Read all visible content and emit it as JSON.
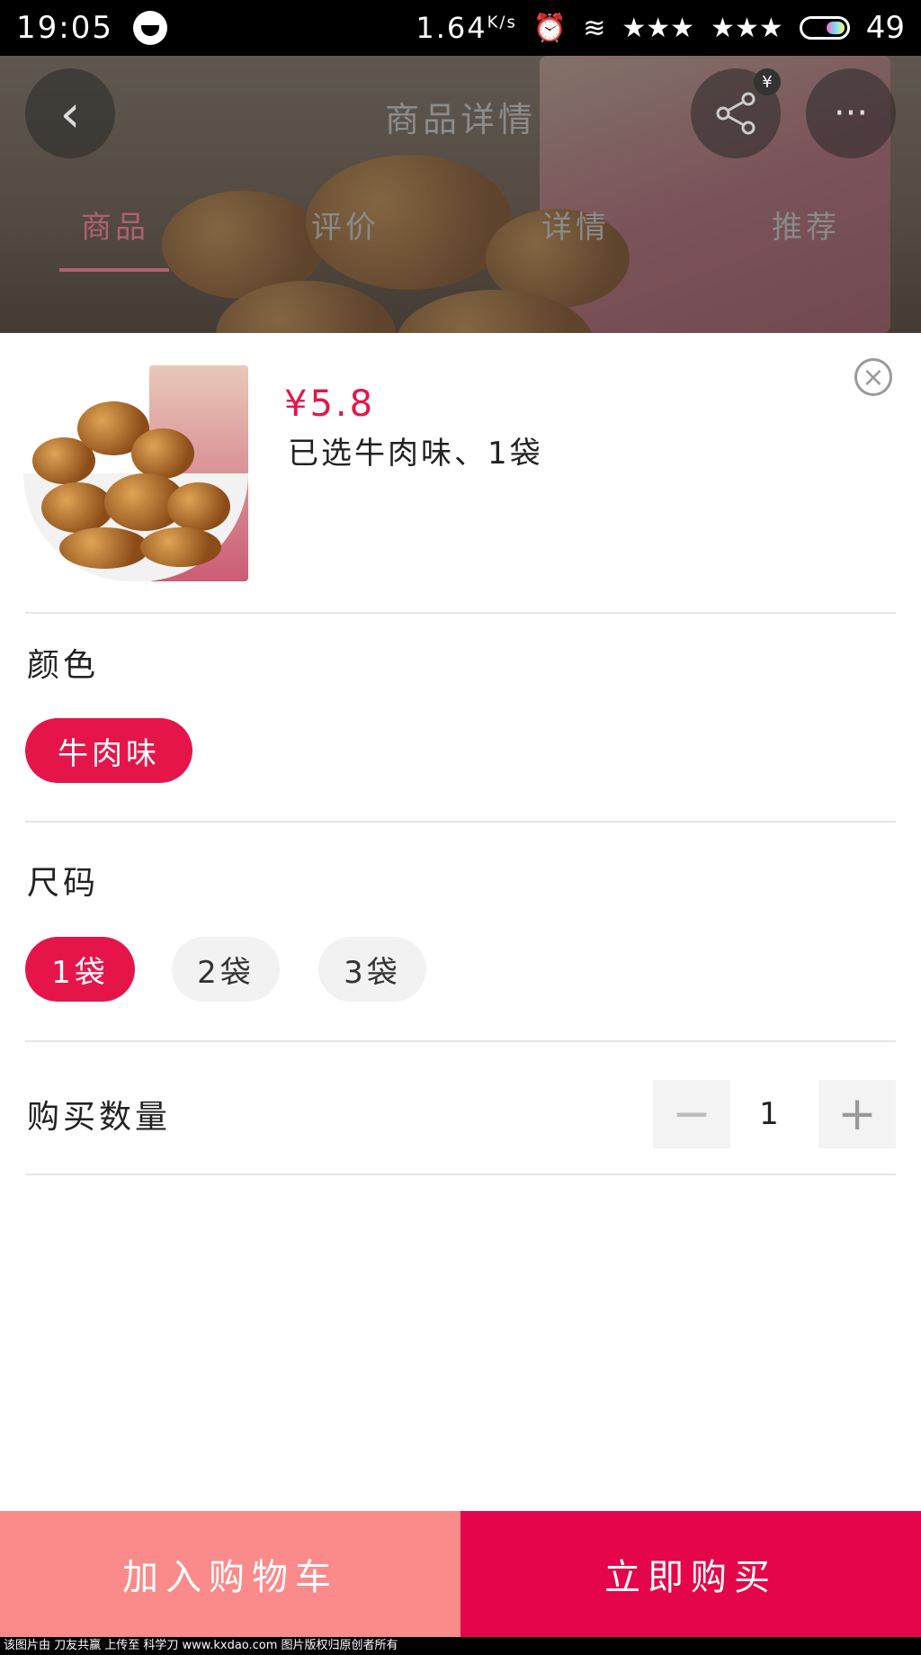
{
  "status_bar": {
    "time": "19:05",
    "speed": "1.64",
    "speed_unit": "K/s",
    "battery": "49"
  },
  "header": {
    "title": "商品详情",
    "back_icon": "chevron-left-icon",
    "share_icon": "share-icon",
    "more_icon": "more-icon",
    "badge": "¥",
    "tabs": [
      {
        "label": "商品",
        "active": true
      },
      {
        "label": "评价",
        "active": false
      },
      {
        "label": "详情",
        "active": false
      },
      {
        "label": "推荐",
        "active": false
      }
    ]
  },
  "sheet": {
    "price": "¥5.8",
    "selected_text": "已选牛肉味、1袋",
    "color_section": {
      "label": "颜色",
      "options": [
        {
          "label": "牛肉味",
          "selected": true
        }
      ]
    },
    "size_section": {
      "label": "尺码",
      "options": [
        {
          "label": "1袋",
          "selected": true
        },
        {
          "label": "2袋",
          "selected": false
        },
        {
          "label": "3袋",
          "selected": false
        }
      ]
    },
    "quantity": {
      "label": "购买数量",
      "minus": "−",
      "value": "1",
      "plus": "+"
    }
  },
  "actions": {
    "add_to_cart": "加入购物车",
    "buy_now": "立即购买"
  },
  "colors": {
    "accent": "#e5154a",
    "cart_button": "#fb8b8b",
    "buy_button": "#e5054a"
  },
  "watermark": "该图片由 刀友共赢 上传至 科学刀 www.kxdao.com 图片版权归原创者所有"
}
